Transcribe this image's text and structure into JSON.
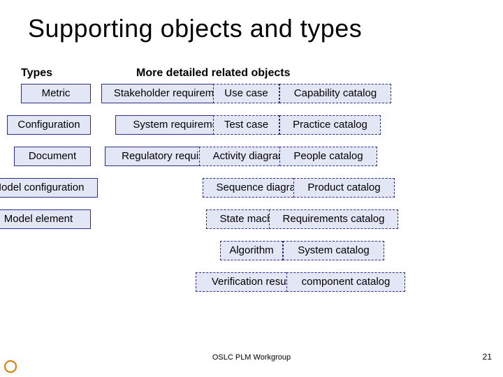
{
  "title": "Supporting objects and types",
  "headings": {
    "types": "Types",
    "more": "More detailed related objects"
  },
  "types_col": {
    "metric": "Metric",
    "configuration": "Configuration",
    "document": "Document",
    "model_configuration": "Model configuration",
    "model_element": "Model element"
  },
  "col_req": {
    "stakeholder": "Stakeholder requirement",
    "system": "System requirement",
    "regulatory": "Regulatory requirement"
  },
  "col_mid": {
    "use_case": "Use case",
    "test_case": "Test case",
    "activity_diagram": "Activity diagram",
    "sequence_diagram": "Sequence diagram",
    "state_machine": "State machine",
    "algorithm": "Algorithm",
    "verification_result": "Verification result"
  },
  "col_catalog": {
    "capability": "Capability catalog",
    "practice": "Practice catalog",
    "people": "People catalog",
    "product": "Product catalog",
    "requirements": "Requirements catalog",
    "system": "System catalog",
    "component": "component catalog"
  },
  "footer": "OSLC PLM Workgroup",
  "page_number": "21"
}
